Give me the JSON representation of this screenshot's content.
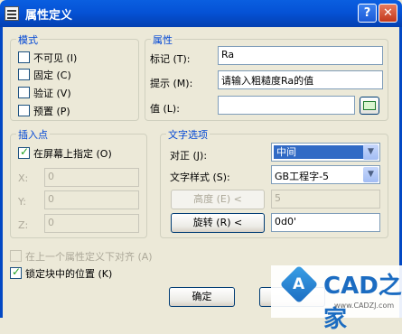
{
  "window": {
    "title": "属性定义",
    "help": "?",
    "close": "✕"
  },
  "mode": {
    "legend": "模式",
    "options": [
      {
        "label": "不可见 (I)",
        "checked": false
      },
      {
        "label": "固定 (C)",
        "checked": false
      },
      {
        "label": "验证 (V)",
        "checked": false
      },
      {
        "label": "预置 (P)",
        "checked": false
      }
    ]
  },
  "attribute": {
    "legend": "属性",
    "tag_label": "标记 (T):",
    "tag_value": "Ra",
    "prompt_label": "提示 (M):",
    "prompt_value": "请输入粗糙度Ra的值",
    "value_label": "值 (L):",
    "value_value": ""
  },
  "insertion": {
    "legend": "插入点",
    "specify_label": "在屏幕上指定 (O)",
    "specify_checked": true,
    "x_label": "X:",
    "x_value": "0",
    "y_label": "Y:",
    "y_value": "0",
    "z_label": "Z:",
    "z_value": "0"
  },
  "text": {
    "legend": "文字选项",
    "justify_label": "对正 (J):",
    "justify_value": "中间",
    "style_label": "文字样式 (S):",
    "style_value": "GB工程字-5",
    "height_button": "高度 (E) <",
    "height_value": "5",
    "rotate_button": "旋转 (R) <",
    "rotate_value": "0d0'"
  },
  "align_below": {
    "label": "在上一个属性定义下对齐 (A)",
    "checked": false,
    "enabled": false
  },
  "lock_position": {
    "label": "锁定块中的位置 (K)",
    "checked": true
  },
  "ok_button": "确定",
  "watermark": {
    "text": "CAD之家",
    "logo_letter": "A",
    "url": "www.CADZJ.com"
  }
}
